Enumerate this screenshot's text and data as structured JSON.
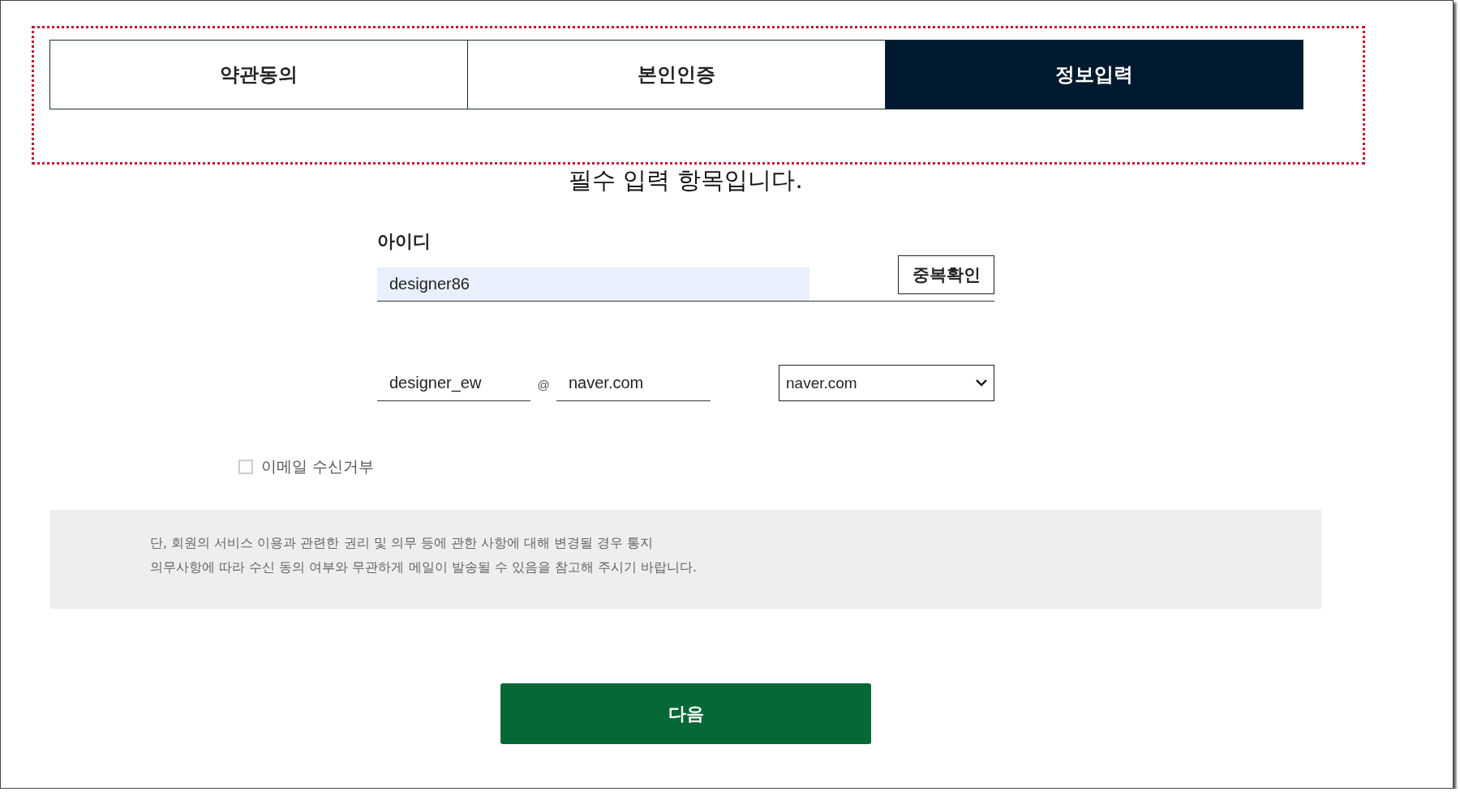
{
  "annotation": {
    "kind": "dotted-frame"
  },
  "tabs": [
    {
      "label": "약관동의",
      "selected": false
    },
    {
      "label": "본인인증",
      "selected": false
    },
    {
      "label": "정보입력",
      "selected": true
    }
  ],
  "heading": "필수 입력 항목입니다.",
  "id_field": {
    "label": "아이디",
    "value": "designer86",
    "button": "중복확인"
  },
  "email": {
    "local": "designer_ew",
    "at": "@",
    "domain": "naver.com",
    "select": "naver.com"
  },
  "email_opt_out": {
    "label": "이메일 수신거부",
    "checked": false
  },
  "notice": [
    "단, 회원의 서비스 이용과 관련한 권리 및 의무 등에 관한 사항에 대해 변경될 경우 통지",
    "의무사항에 따라 수신 동의 여부와 무관하게 메일이 발송될 수 있음을 참고해 주시기 바랍니다."
  ],
  "next_button": "다음"
}
